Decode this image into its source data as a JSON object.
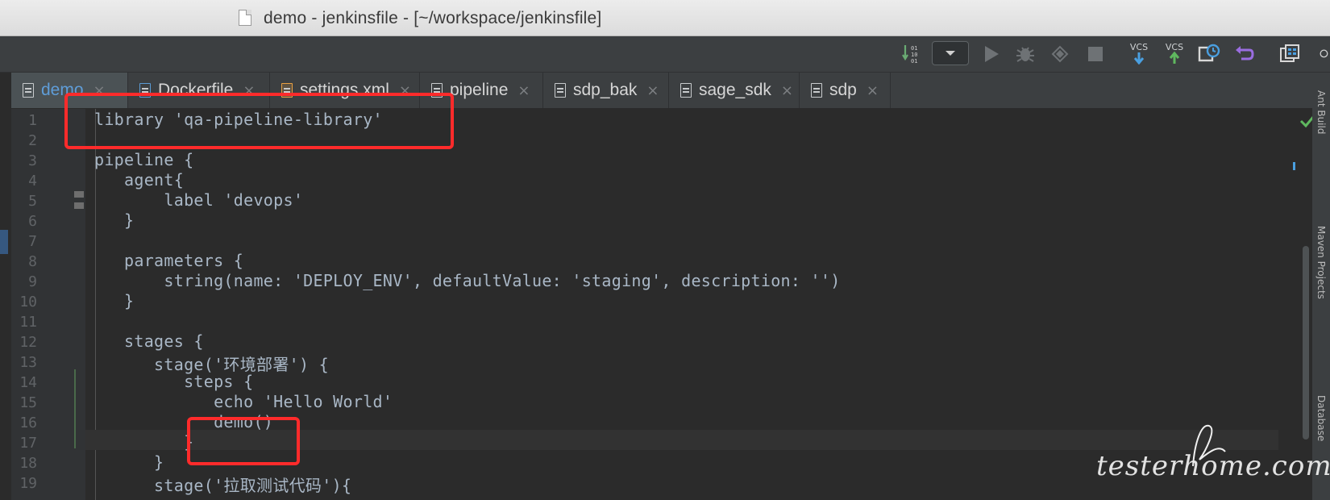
{
  "window": {
    "title": "demo - jenkinsfile - [~/workspace/jenkinsfile]"
  },
  "toolbar": {
    "vcs_update_label": "VCS",
    "vcs_commit_label": "VCS"
  },
  "tabs": [
    {
      "label": "demo",
      "icon": "file-icon",
      "active": true
    },
    {
      "label": "Dockerfile",
      "icon": "docker-file-icon"
    },
    {
      "label": "settings.xml",
      "icon": "xml-file-icon"
    },
    {
      "label": "pipeline",
      "icon": "file-icon"
    },
    {
      "label": "sdp_bak",
      "icon": "file-icon"
    },
    {
      "label": "sage_sdk",
      "icon": "file-icon"
    },
    {
      "label": "sdp",
      "icon": "file-icon"
    }
  ],
  "tab_close_glyph": "×",
  "editor": {
    "line_numbers": [
      "1",
      "2",
      "3",
      "4",
      "5",
      "6",
      "7",
      "8",
      "9",
      "10",
      "11",
      "12",
      "13",
      "14",
      "15",
      "16",
      "17",
      "18",
      "19"
    ],
    "lines": [
      "library 'qa-pipeline-library'",
      "",
      "pipeline {",
      "   agent{",
      "       label 'devops'",
      "   }",
      "",
      "   parameters {",
      "       string(name: 'DEPLOY_ENV', defaultValue: 'staging', description: '')",
      "   }",
      "",
      "   stages {",
      "      stage('环境部署') {",
      "         steps {",
      "            echo 'Hello World'",
      "            demo()",
      "         }",
      "      }",
      "      stage('拉取测试代码'){"
    ]
  },
  "right_tool_windows": [
    "Ant Build",
    "Maven Projects",
    "Database"
  ],
  "watermark": {
    "text": "testerhome.com"
  },
  "colors": {
    "annotation_red": "#ff2b2b",
    "editor_bg": "#2b2b2b",
    "active_tab_text": "#5f9dd8",
    "brace_highlight": "#ffef28"
  }
}
